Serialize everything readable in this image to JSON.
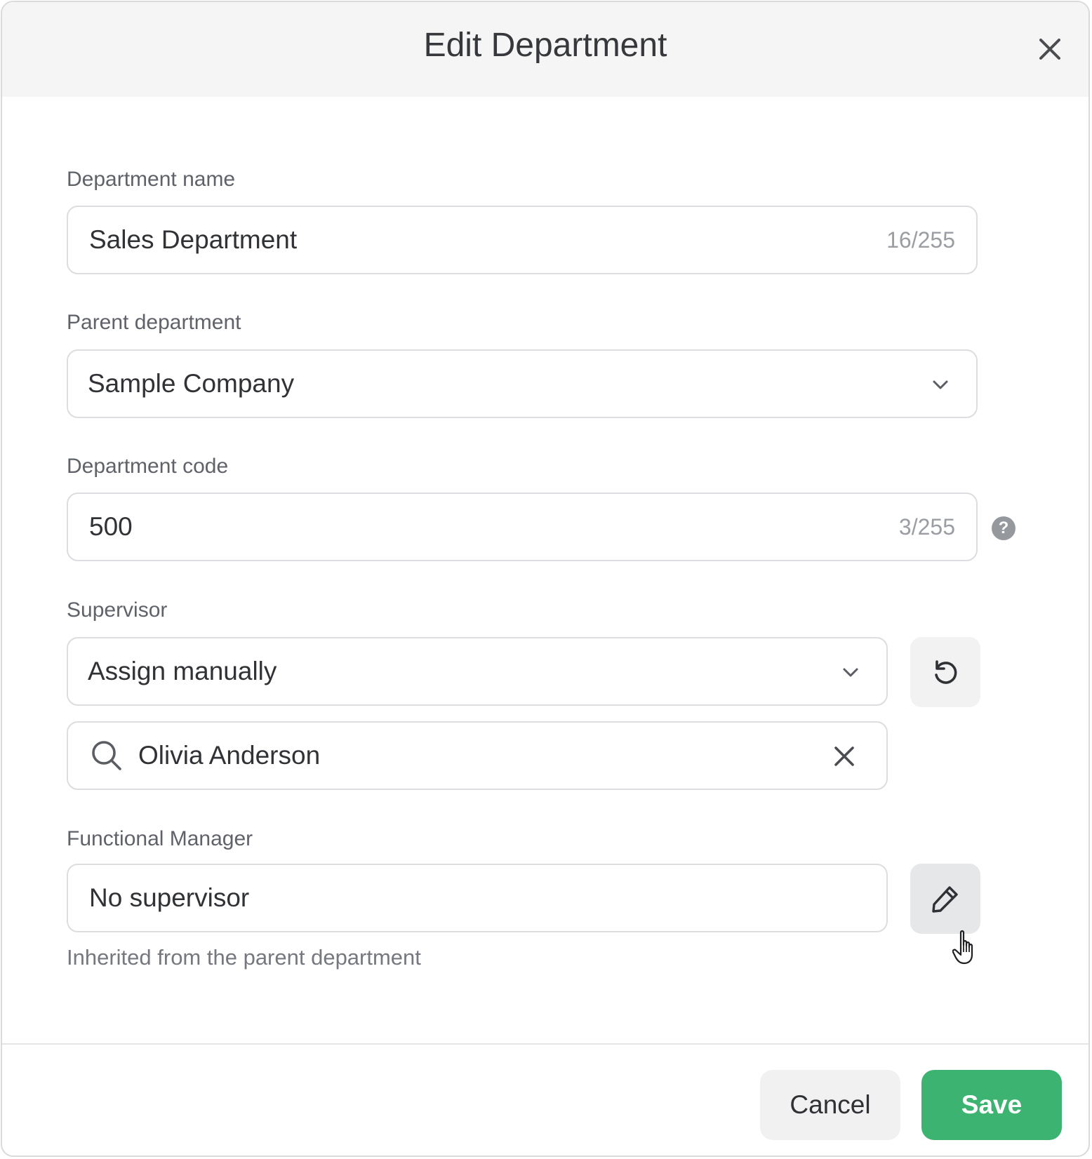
{
  "dialog": {
    "title": "Edit Department",
    "close_icon": "close-icon"
  },
  "department_name": {
    "label": "Department name",
    "value": "Sales Department",
    "counter": "16/255"
  },
  "parent_department": {
    "label": "Parent department",
    "value": "Sample Company",
    "icon": "chevron-down-icon"
  },
  "department_code": {
    "label": "Department code",
    "value": "500",
    "counter": "3/255",
    "help_icon": "?"
  },
  "supervisor": {
    "label": "Supervisor",
    "mode": "Assign manually",
    "reset_icon": "refresh-icon",
    "search": {
      "icon": "search-icon",
      "value": "Olivia Anderson",
      "clear_icon": "close-icon"
    }
  },
  "functional_manager": {
    "label": "Functional Manager",
    "value": "No supervisor",
    "edit_icon": "pencil-icon",
    "hint": "Inherited from the parent department"
  },
  "footer": {
    "cancel_label": "Cancel",
    "save_label": "Save"
  },
  "colors": {
    "accent": "#3cb371",
    "header_bg": "#f5f5f6",
    "border": "#dcdde0"
  }
}
